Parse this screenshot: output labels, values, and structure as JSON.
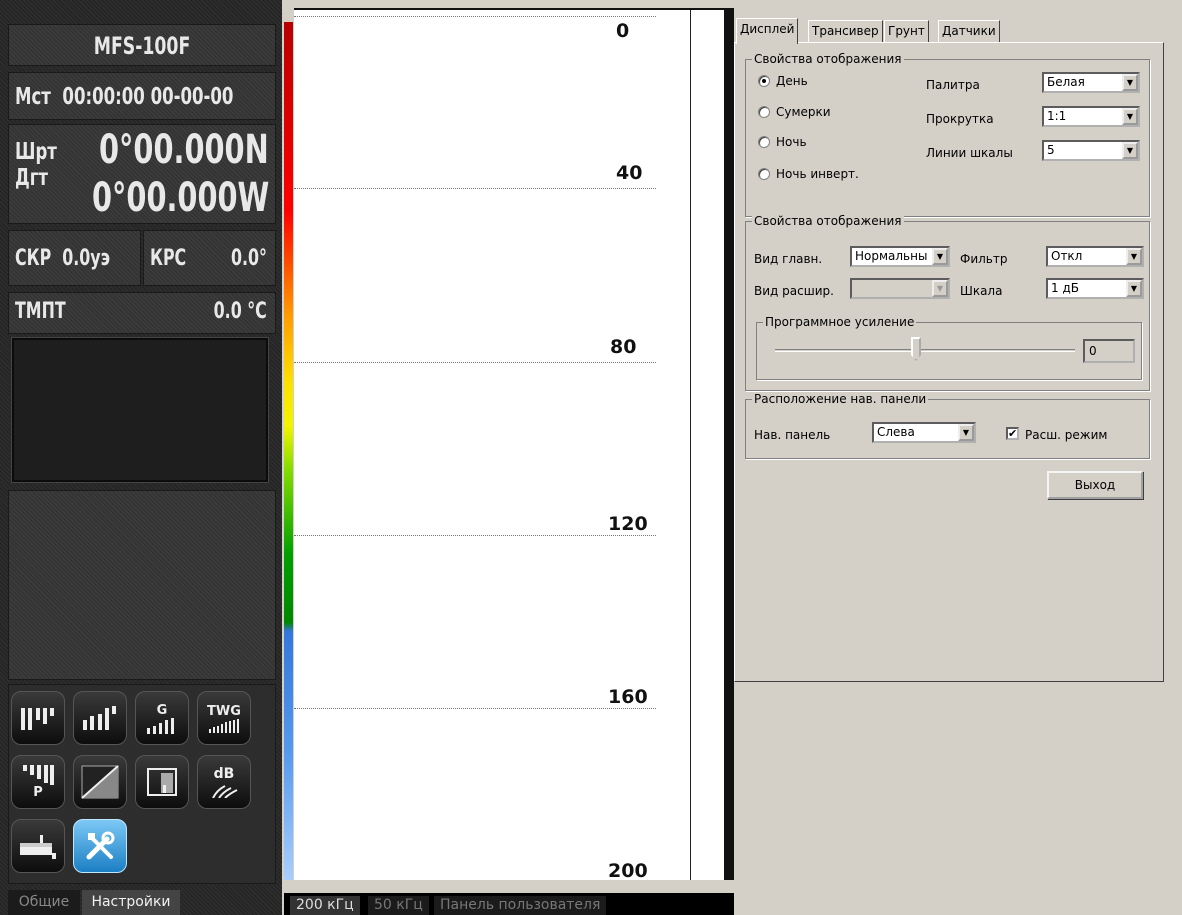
{
  "nav": {
    "model": "MFS-100F",
    "time_label": "Мст",
    "time_value": "00:00:00 00-00-00",
    "lat_label": "Шрт",
    "lat_value": "0°00.000N",
    "lon_label": "Дгт",
    "lon_value": "0°00.000W",
    "speed_label": "СКР",
    "speed_value": "0.0уэ",
    "course_label": "КРС",
    "course_value": "0.0°",
    "temp_label": "ТМПТ",
    "temp_value": "0.0 °C",
    "icons": [
      "bar-chart-icon",
      "bar-chart-rising-icon",
      "gain-g-icon",
      "twg-icon",
      "power-p-icon",
      "bottom-texture-icon",
      "zoom-window-icon",
      "db-signal-icon",
      "depth-marker-icon",
      "tools-icon"
    ],
    "icon_labels": {
      "gain": "G",
      "twg": "TWG",
      "power": "P",
      "db": "dB"
    },
    "tabs": [
      "Общие",
      "Настройки"
    ],
    "active_tab": 1
  },
  "sonar": {
    "depth_labels": [
      "0",
      "40",
      "80",
      "120",
      "160",
      "200"
    ],
    "freq_tabs": [
      "200 кГц",
      "50 кГц",
      "Панель пользователя"
    ],
    "active_freq": 0
  },
  "dialog": {
    "tabs": [
      "Дисплей",
      "Трансивер",
      "Грунт",
      "Датчики"
    ],
    "active_tab": 0,
    "group1": {
      "title": "Свойства отображения",
      "radios": [
        "День",
        "Сумерки",
        "Ночь",
        "Ночь инверт."
      ],
      "selected_radio": 0,
      "palette_label": "Палитра",
      "palette_value": "Белая",
      "scroll_label": "Прокрутка",
      "scroll_value": "1:1",
      "lines_label": "Линии шкалы",
      "lines_value": "5"
    },
    "group2": {
      "title": "Свойства отображения",
      "main_view_label": "Вид главн.",
      "main_view_value": "Нормальны",
      "filter_label": "Фильтр",
      "filter_value": "Откл",
      "ext_view_label": "Вид расшир.",
      "ext_view_value": "",
      "scale_label": "Шкала",
      "scale_value": "1 дБ",
      "gain_title": "Программное усиление",
      "gain_value": "0",
      "gain_slider_fraction": 0.47
    },
    "group3": {
      "title": "Расположение нав. панели",
      "nav_panel_label": "Нав. панель",
      "nav_panel_value": "Слева",
      "ext_mode_label": "Расш. режим",
      "ext_mode_checked": true
    },
    "exit_label": "Выход"
  }
}
